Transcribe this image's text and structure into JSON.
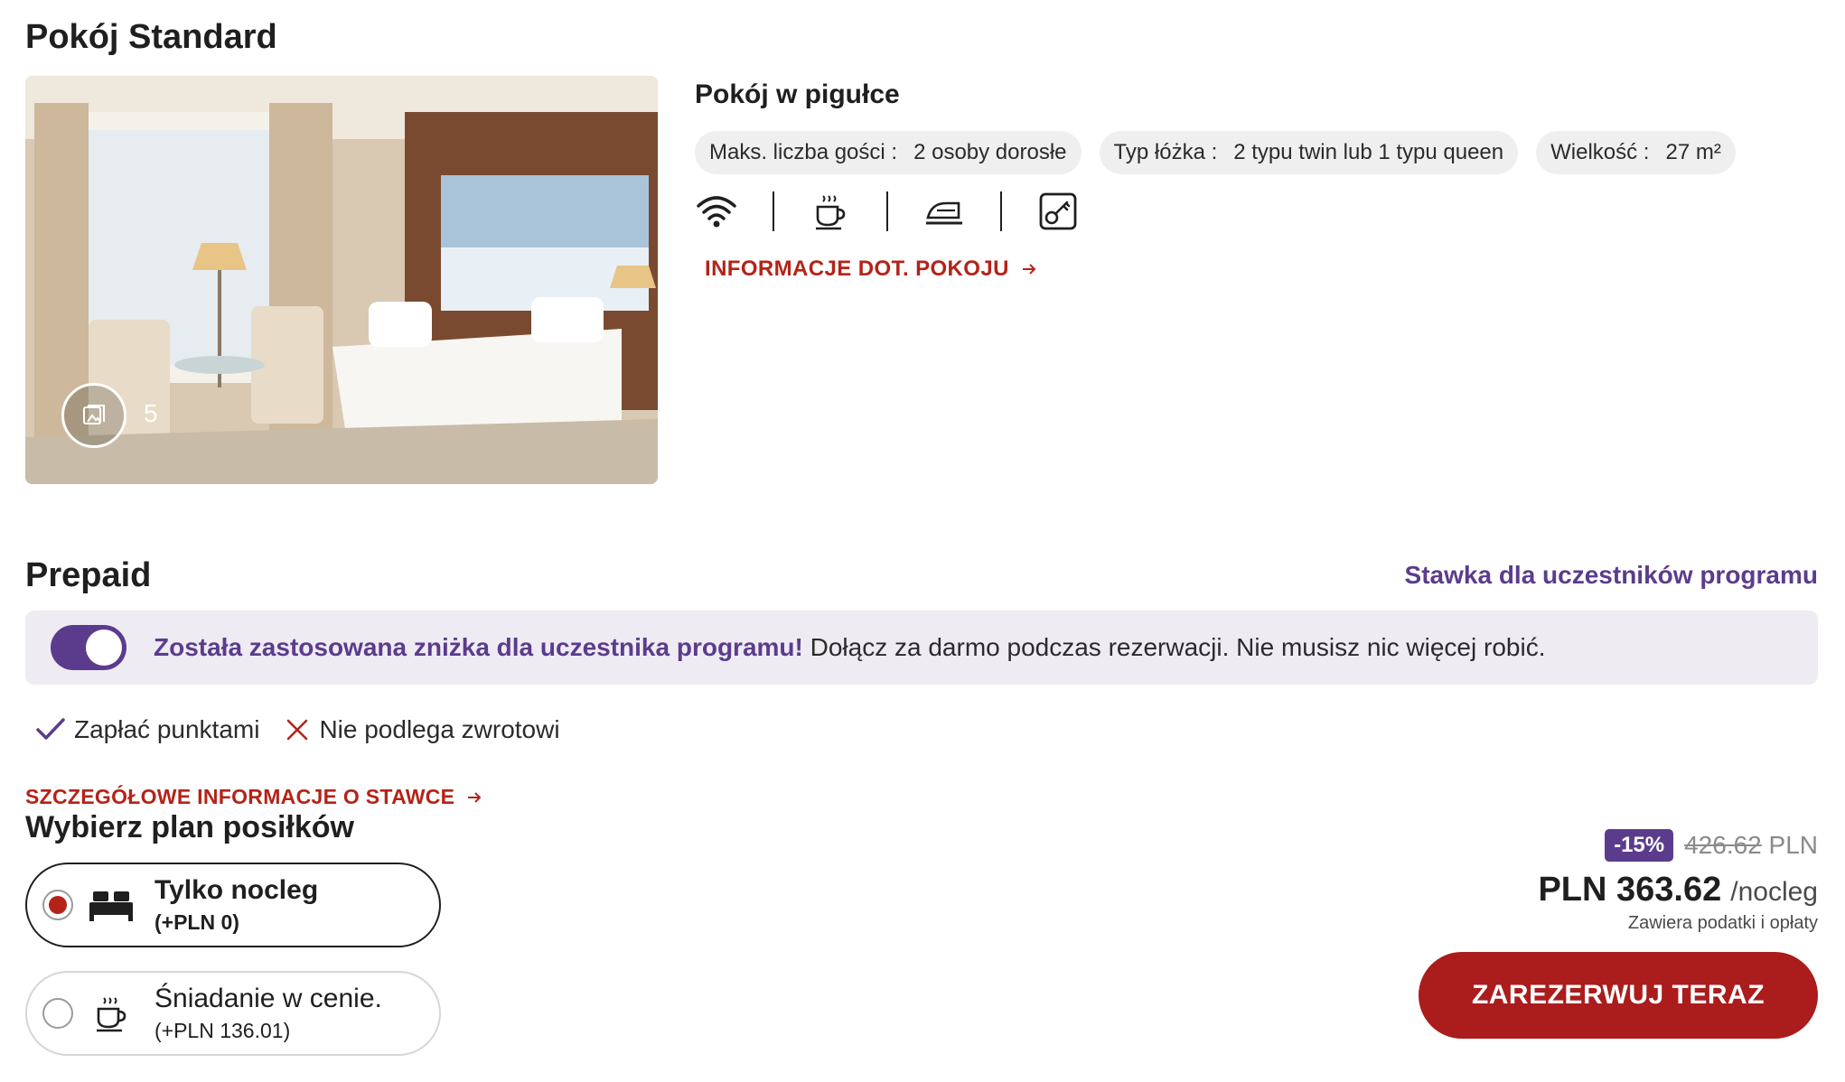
{
  "room": {
    "title": "Pokój Standard",
    "gallery_count": "5",
    "summary_title": "Pokój w pigułce",
    "chips": [
      {
        "label": "Maks. liczba gości :",
        "value": "2 osoby dorosłe"
      },
      {
        "label": "Typ łóżka :",
        "value": "2 typu twin lub 1 typu queen"
      },
      {
        "label": "Wielkość :",
        "value": "27 m²"
      }
    ],
    "amenities": [
      "wifi-icon",
      "coffee-icon",
      "iron-icon",
      "key-card-icon"
    ],
    "info_link": "INFORMACJE DOT. POKOJU"
  },
  "rate": {
    "title": "Prepaid",
    "member_rate_label": "Stawka dla uczestników programu",
    "banner_strong": "Została zastosowana zniżka dla uczestnika programu!",
    "banner_text": " Dołącz za darmo podczas rezerwacji. Nie musisz nic więcej robić.",
    "features": [
      {
        "icon": "check-icon",
        "label": "Zapłać punktami"
      },
      {
        "icon": "cross-icon",
        "label": "Nie podlega zwrotowi"
      }
    ],
    "details_link": "SZCZEGÓŁOWE INFORMACJE O STAWCE"
  },
  "meal_plan": {
    "title": "Wybierz plan posiłków",
    "options": [
      {
        "name": "Tylko nocleg",
        "price": "(+PLN 0)",
        "icon": "bed-icon",
        "selected": true
      },
      {
        "name": "Śniadanie w cenie.",
        "price": "(+PLN 136.01)",
        "icon": "coffee-icon",
        "selected": false
      }
    ]
  },
  "price": {
    "discount": "-15%",
    "old_amount": "426.62",
    "old_currency": " PLN",
    "current": "PLN 363.62",
    "unit": "/nocleg",
    "taxes_note": "Zawiera podatki i opłaty",
    "book_label": "ZAREZERWUJ TERAZ"
  },
  "colors": {
    "accent_purple": "#5b3c8c",
    "accent_red": "#b42318",
    "button_red": "#ab1c1c",
    "banner_bg": "#eeebf3"
  }
}
